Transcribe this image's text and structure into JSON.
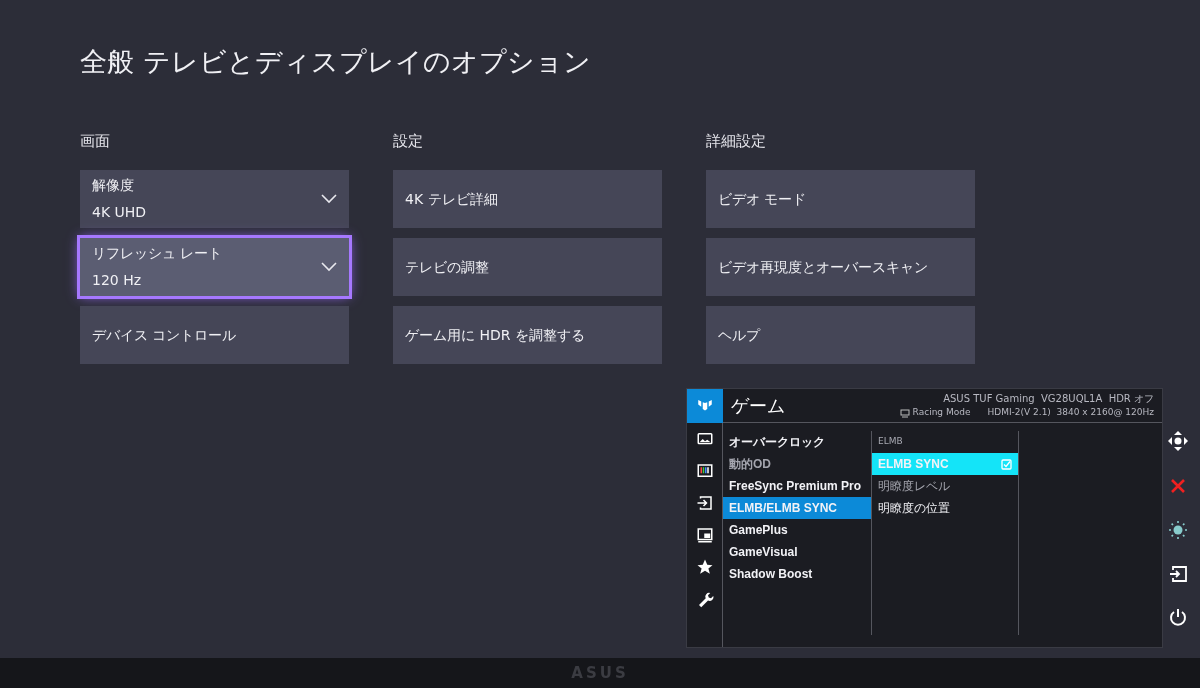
{
  "title": "全般 テレビとディスプレイのオプション",
  "columns": [
    {
      "heading": "画面",
      "items": [
        {
          "kind": "dropdown",
          "label": "解像度",
          "value": "4K UHD",
          "focused": false
        },
        {
          "kind": "dropdown",
          "label": "リフレッシュ レート",
          "value": "120 Hz",
          "focused": true
        },
        {
          "kind": "button",
          "label": "デバイス コントロール",
          "focused": false
        }
      ]
    },
    {
      "heading": "設定",
      "items": [
        {
          "kind": "button",
          "label": "4K テレビ詳細",
          "focused": false
        },
        {
          "kind": "button",
          "label": "テレビの調整",
          "focused": false
        },
        {
          "kind": "button",
          "label": "ゲーム用に HDR を調整する",
          "focused": false
        }
      ]
    },
    {
      "heading": "詳細設定",
      "items": [
        {
          "kind": "button",
          "label": "ビデオ モード",
          "focused": false
        },
        {
          "kind": "button",
          "label": "ビデオ再現度とオーバースキャン",
          "focused": false
        },
        {
          "kind": "button",
          "label": "ヘルプ",
          "focused": false
        }
      ]
    }
  ],
  "osd": {
    "title": "ゲーム",
    "model": "ASUS TUF Gaming  VG28UQL1A  HDR オフ",
    "mode": "Racing Mode",
    "signal": "HDMI-2(V 2.1)  3840 x 2160@ 120Hz",
    "tabs": [
      {
        "kind": "logo",
        "selected": true
      },
      {
        "kind": "image",
        "selected": false
      },
      {
        "kind": "color",
        "selected": false
      },
      {
        "kind": "input",
        "selected": false
      },
      {
        "kind": "pip",
        "selected": false
      },
      {
        "kind": "favorite",
        "selected": false
      },
      {
        "kind": "system",
        "selected": false
      }
    ],
    "menu": [
      {
        "label": "オーバークロック",
        "selected": false,
        "disabled": false
      },
      {
        "label": "動的OD",
        "selected": false,
        "disabled": true
      },
      {
        "label": "FreeSync Premium Pro",
        "selected": false,
        "disabled": false
      },
      {
        "label": "ELMB/ELMB SYNC",
        "selected": true,
        "disabled": false
      },
      {
        "label": "GamePlus",
        "selected": false,
        "disabled": false
      },
      {
        "label": "GameVisual",
        "selected": false,
        "disabled": false
      },
      {
        "label": "Shadow Boost",
        "selected": false,
        "disabled": false
      }
    ],
    "submenu": [
      {
        "kind": "header",
        "label": "ELMB"
      },
      {
        "kind": "option",
        "label": "ELMB SYNC",
        "selected": true,
        "checked": true,
        "disabled": false
      },
      {
        "kind": "option",
        "label": "明瞭度レベル",
        "selected": false,
        "checked": false,
        "disabled": true
      },
      {
        "kind": "option",
        "label": "明瞭度の位置",
        "selected": false,
        "checked": false,
        "disabled": false
      }
    ]
  },
  "bezel_logo": "ASUS"
}
